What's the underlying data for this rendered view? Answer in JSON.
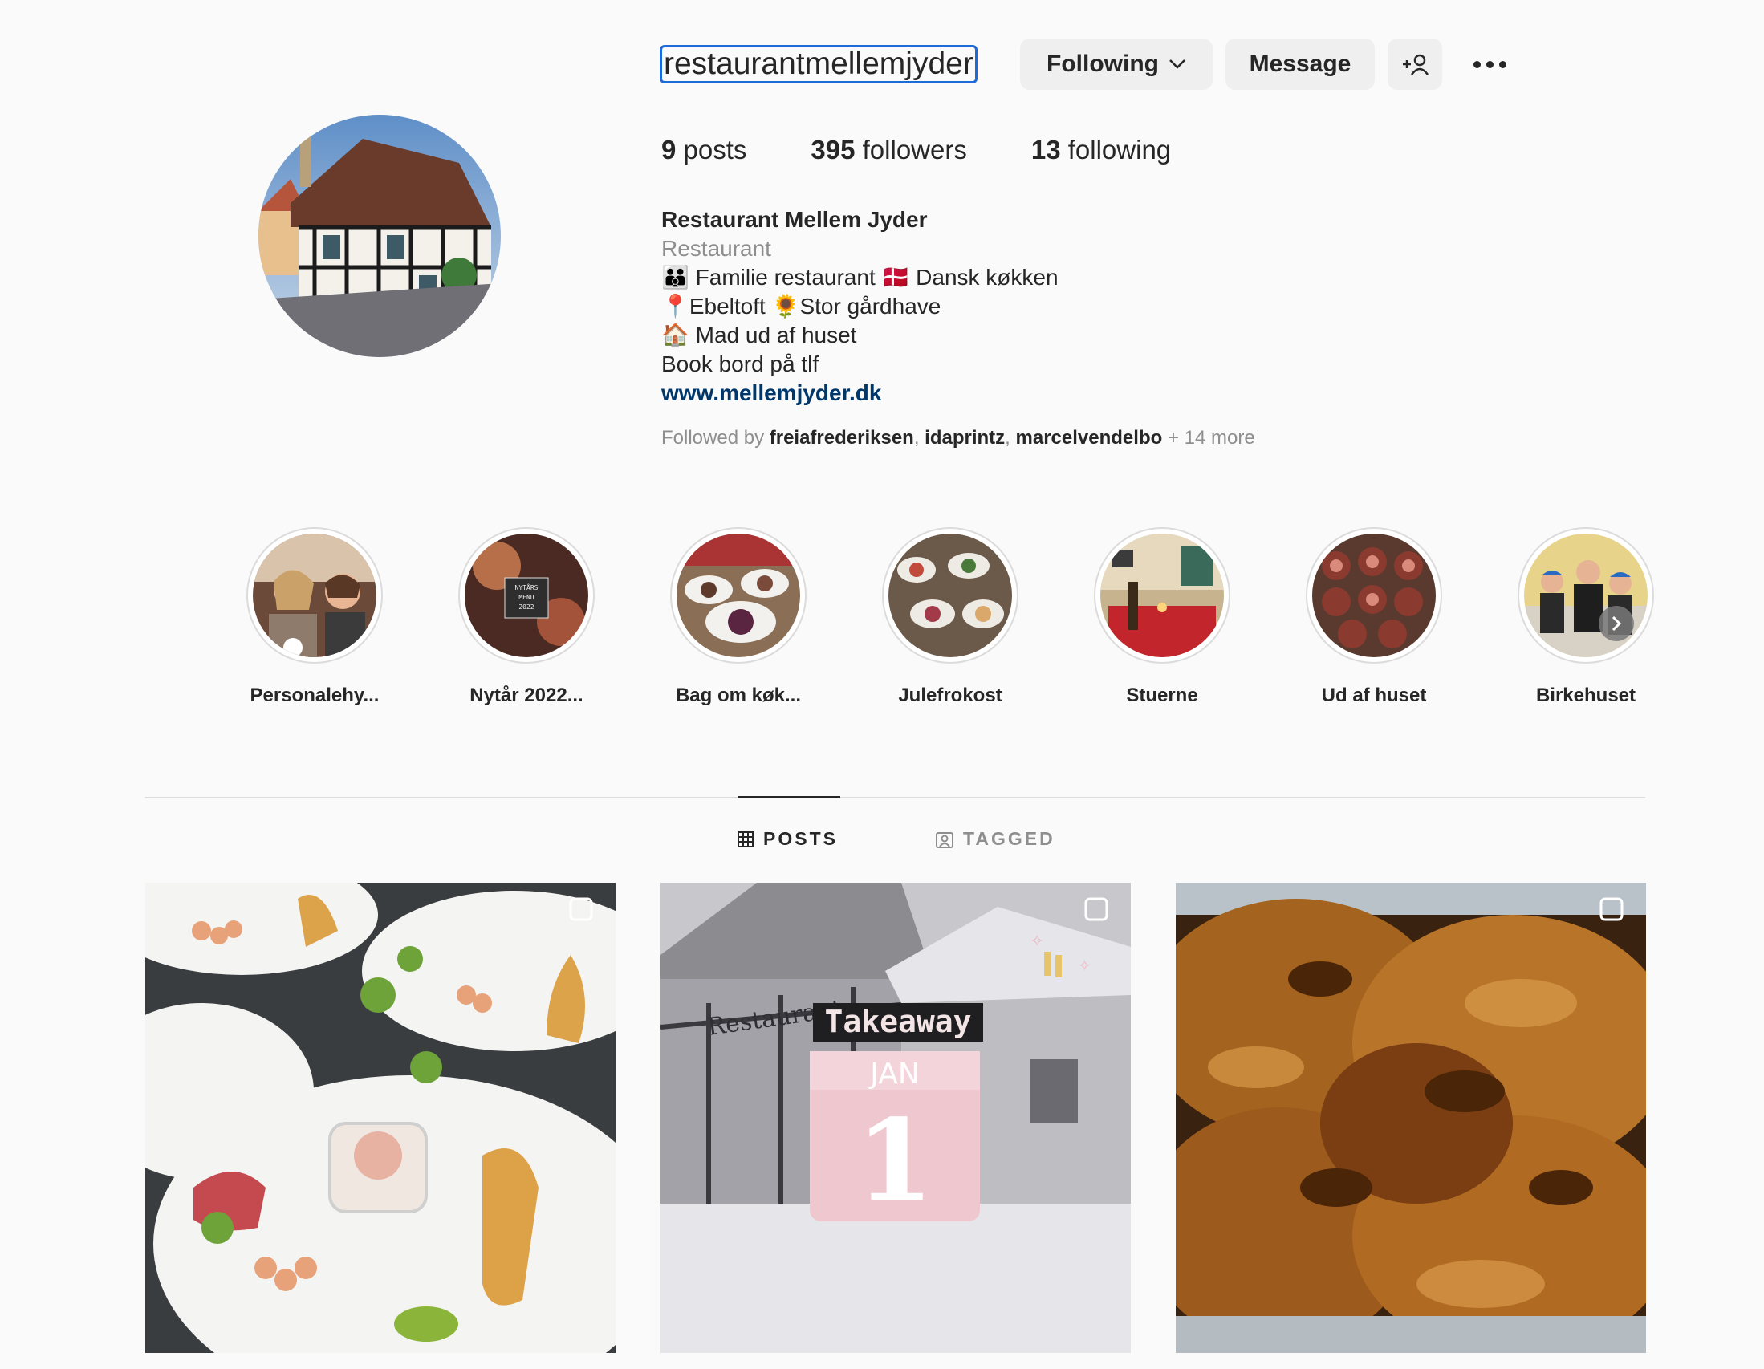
{
  "profile": {
    "username": "restaurantmellemjyder",
    "buttons": {
      "following": "Following",
      "message": "Message"
    },
    "stats": [
      {
        "count": "9",
        "label": "posts"
      },
      {
        "count": "395",
        "label": "followers"
      },
      {
        "count": "13",
        "label": "following"
      }
    ],
    "bio": {
      "name": "Restaurant Mellem Jyder",
      "category": "Restaurant",
      "lines": [
        "👪 Familie restaurant 🇩🇰 Dansk køkken",
        "📍Ebeltoft 🌻Stor gårdhave",
        "🏠 Mad ud af huset",
        "Book bord på tlf"
      ],
      "link": "www.mellemjyder.dk"
    },
    "followed_by": {
      "prefix": "Followed by",
      "users": [
        "freiafrederiksen",
        "idaprintz",
        "marcelvendelbo"
      ],
      "more": "+ 14 more"
    }
  },
  "highlights": [
    {
      "label": "Personalehy..."
    },
    {
      "label": "Nytår 2022..."
    },
    {
      "label": "Bag om køk..."
    },
    {
      "label": "Julefrokost"
    },
    {
      "label": "Stuerne"
    },
    {
      "label": "Ud af huset"
    },
    {
      "label": "Birkehuset"
    }
  ],
  "tabs": {
    "posts": "POSTS",
    "tagged": "TAGGED"
  },
  "posts": [
    {
      "icon": "multiple-images-icon"
    },
    {
      "icon": "multiple-images-icon",
      "overlay_text": "Takeaway",
      "calendar_month": "JAN",
      "calendar_day": "1",
      "sign": "Restaurant"
    },
    {
      "icon": "multiple-images-icon"
    }
  ]
}
